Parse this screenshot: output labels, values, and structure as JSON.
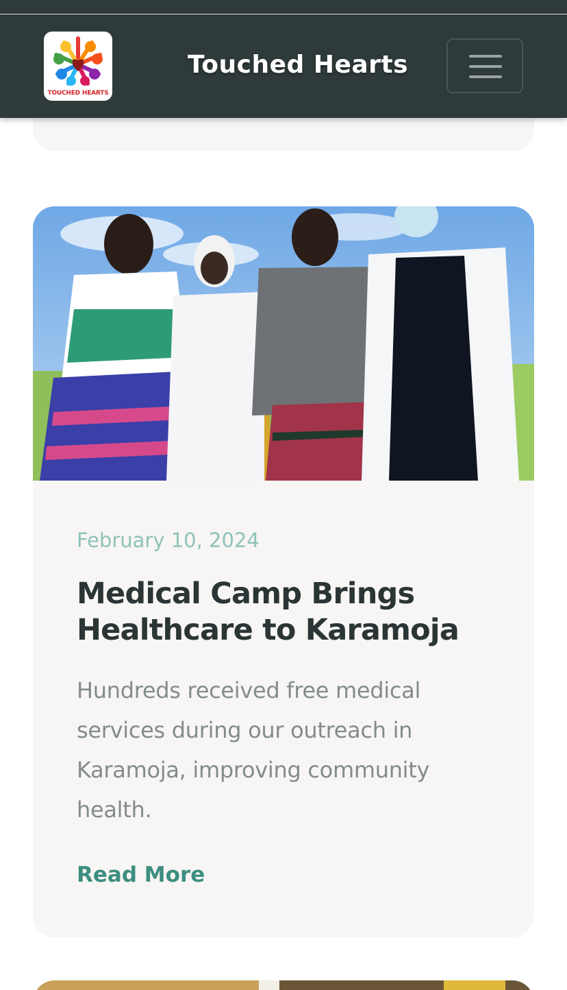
{
  "navbar": {
    "brand": "Touched Hearts",
    "logo_text": "TOUCHED HEARTS",
    "toggle_icon": "hamburger-menu-icon",
    "background": "#2f3a3a"
  },
  "post": {
    "date": "February 10, 2024",
    "title": "Medical Camp Brings Healthcare to Karamoja",
    "excerpt": "Hundreds received free medical services during our outreach in Karamoja, improving community health.",
    "read_more": "Read More",
    "accent_color": "#3d8e80"
  }
}
